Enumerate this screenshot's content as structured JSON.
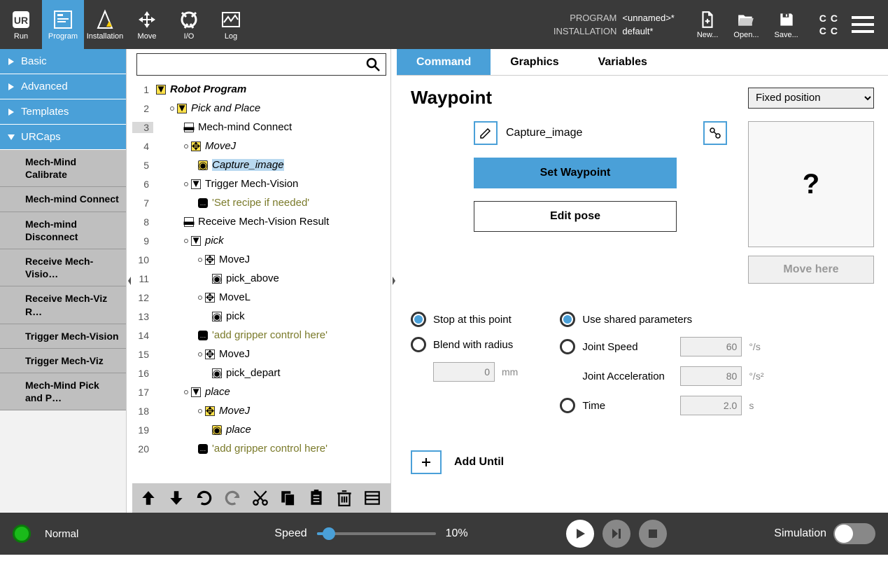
{
  "header": {
    "tabs": [
      {
        "label": "Run"
      },
      {
        "label": "Program"
      },
      {
        "label": "Installation"
      },
      {
        "label": "Move"
      },
      {
        "label": "I/O"
      },
      {
        "label": "Log"
      }
    ],
    "program_label": "PROGRAM",
    "program_value": "<unnamed>*",
    "installation_label": "INSTALLATION",
    "installation_value": "default*",
    "actions": {
      "new": "New...",
      "open": "Open...",
      "save": "Save..."
    }
  },
  "sidebar": {
    "cats": [
      {
        "label": "Basic"
      },
      {
        "label": "Advanced"
      },
      {
        "label": "Templates"
      },
      {
        "label": "URCaps"
      }
    ],
    "urcaps": [
      "Mech-Mind Calibrate",
      "Mech-mind Connect",
      "Mech-mind Disconnect",
      "Receive Mech-Visio…",
      "Receive Mech-Viz R…",
      "Trigger Mech-Vision",
      "Trigger Mech-Viz",
      "Mech-Mind Pick and P…"
    ]
  },
  "tree": [
    {
      "n": "1",
      "indent": 0,
      "icon": "yel-tri",
      "text": "Robot Program",
      "style": "bold italic"
    },
    {
      "n": "2",
      "indent": 1,
      "icon": "yel-tri",
      "text": "Pick and Place",
      "style": "italic",
      "dot": true
    },
    {
      "n": "3",
      "indent": 2,
      "icon": "minus",
      "text": "Mech-mind Connect",
      "hl": true
    },
    {
      "n": "4",
      "indent": 2,
      "icon": "yel-move",
      "text": "MoveJ",
      "style": "italic",
      "dot": true
    },
    {
      "n": "5",
      "indent": 3,
      "icon": "yel-target",
      "text": "Capture_image",
      "style": "italic",
      "selected": true
    },
    {
      "n": "6",
      "indent": 2,
      "icon": "white-tri",
      "text": "Trigger Mech-Vision",
      "dot": true
    },
    {
      "n": "7",
      "indent": 3,
      "icon": "comment",
      "text": "'Set recipe if needed'",
      "style": "olive"
    },
    {
      "n": "8",
      "indent": 2,
      "icon": "minus",
      "text": "Receive Mech-Vision Result"
    },
    {
      "n": "9",
      "indent": 2,
      "icon": "white-tri",
      "text": "pick",
      "style": "italic",
      "dot": true
    },
    {
      "n": "10",
      "indent": 3,
      "icon": "white-move",
      "text": "MoveJ",
      "dot": true
    },
    {
      "n": "11",
      "indent": 4,
      "icon": "white-target",
      "text": "pick_above"
    },
    {
      "n": "12",
      "indent": 3,
      "icon": "white-move",
      "text": "MoveL",
      "dot": true
    },
    {
      "n": "13",
      "indent": 4,
      "icon": "white-target",
      "text": "pick"
    },
    {
      "n": "14",
      "indent": 3,
      "icon": "comment",
      "text": "'add gripper control here'",
      "style": "olive"
    },
    {
      "n": "15",
      "indent": 3,
      "icon": "white-move",
      "text": "MoveJ",
      "dot": true
    },
    {
      "n": "16",
      "indent": 4,
      "icon": "white-target",
      "text": "pick_depart"
    },
    {
      "n": "17",
      "indent": 2,
      "icon": "white-tri",
      "text": "place",
      "style": "italic",
      "dot": true
    },
    {
      "n": "18",
      "indent": 3,
      "icon": "yel-move",
      "text": "MoveJ",
      "style": "italic",
      "dot": true
    },
    {
      "n": "19",
      "indent": 4,
      "icon": "yel-target",
      "text": "place",
      "style": "italic"
    },
    {
      "n": "20",
      "indent": 3,
      "icon": "comment",
      "text": "'add gripper control here'",
      "style": "olive"
    }
  ],
  "cmd": {
    "tabs": [
      {
        "label": "Command",
        "active": true
      },
      {
        "label": "Graphics"
      },
      {
        "label": "Variables"
      }
    ],
    "title": "Waypoint",
    "position_mode": "Fixed position",
    "wp_name": "Capture_image",
    "set_wp": "Set Waypoint",
    "edit_pose": "Edit pose",
    "preview": "?",
    "move_here": "Move here",
    "stop_label": "Stop at this point",
    "blend_label": "Blend with radius",
    "blend_value": "0",
    "blend_unit": "mm",
    "shared_label": "Use shared parameters",
    "js_label": "Joint Speed",
    "js_value": "60",
    "js_unit": "°/s",
    "ja_label": "Joint Acceleration",
    "ja_value": "80",
    "ja_unit": "°/s²",
    "time_label": "Time",
    "time_value": "2.0",
    "time_unit": "s",
    "add_until": "Add Until"
  },
  "bottom": {
    "status": "Normal",
    "speed_label": "Speed",
    "speed_pct": "10%",
    "speed_fill": 10,
    "sim_label": "Simulation"
  }
}
